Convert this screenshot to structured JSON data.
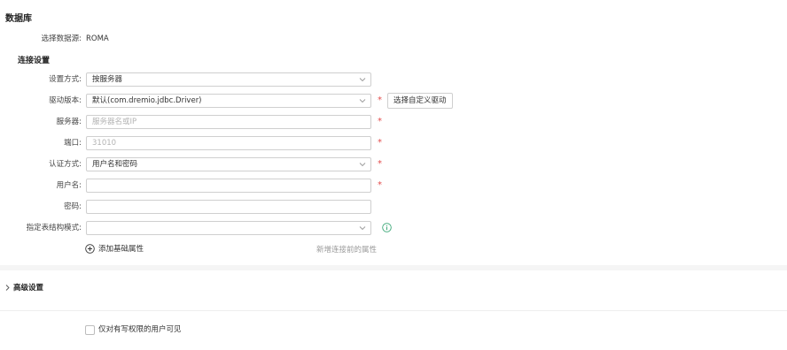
{
  "header": {
    "title": "数据库"
  },
  "source": {
    "label": "选择数据源:",
    "value": "ROMA"
  },
  "connection": {
    "title": "连接设置",
    "method": {
      "label": "设置方式:",
      "value": "按服务器"
    },
    "driver": {
      "label": "驱动版本:",
      "value": "默认(com.dremio.jdbc.Driver)",
      "button": "选择自定义驱动"
    },
    "server": {
      "label": "服务器:",
      "placeholder": "服务器名或IP"
    },
    "port": {
      "label": "端口:",
      "placeholder": "31010"
    },
    "auth": {
      "label": "认证方式:",
      "value": "用户名和密码"
    },
    "username": {
      "label": "用户名:"
    },
    "password": {
      "label": "密码:"
    },
    "schema": {
      "label": "指定表结构模式:"
    },
    "add_property": "添加基础属性",
    "hint": "新增连接前的属性",
    "required_mark": "*"
  },
  "advanced": {
    "title": "高级设置"
  },
  "visibility": {
    "label": "仅对有写权限的用户可见"
  },
  "colors": {
    "required": "#e34d4d",
    "info": "#3aa776"
  }
}
